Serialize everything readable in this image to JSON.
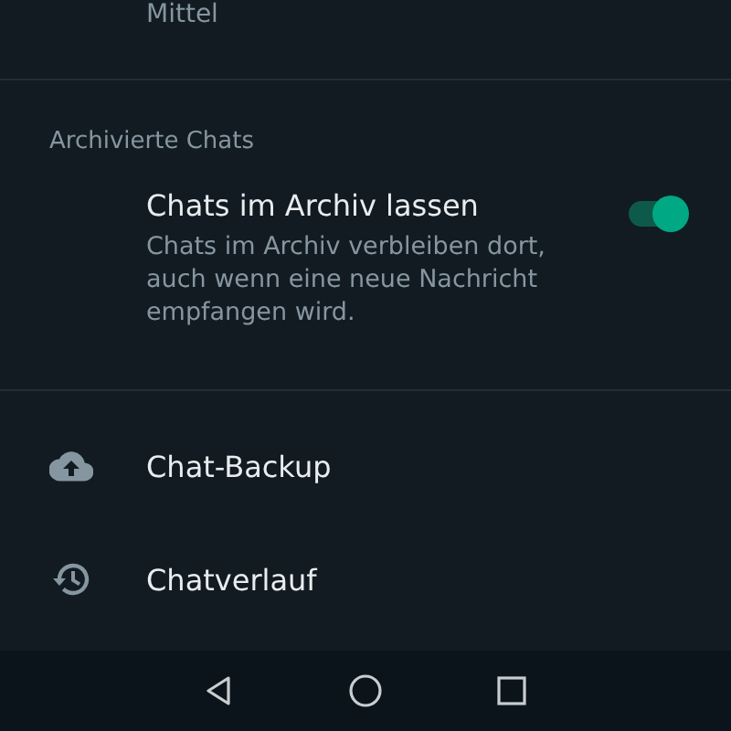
{
  "top_item": {
    "subtitle": "Mittel"
  },
  "section": {
    "header": "Archivierte Chats",
    "setting": {
      "title": "Chats im Archiv lassen",
      "description": "Chats im Archiv verbleiben dort, auch wenn eine neue Nachricht empfangen wird.",
      "on": true
    }
  },
  "items": [
    {
      "kind": "backup",
      "label": "Chat-Backup"
    },
    {
      "kind": "history",
      "label": "Chatverlauf"
    }
  ]
}
